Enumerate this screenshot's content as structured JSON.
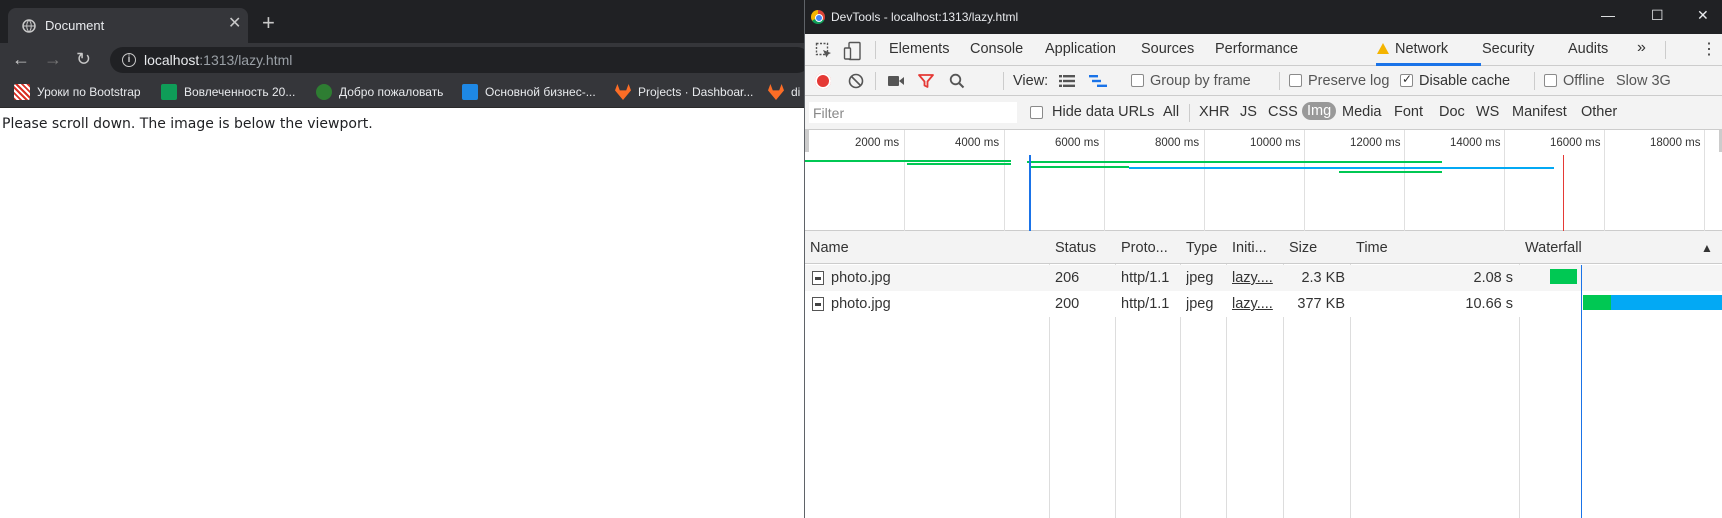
{
  "browser": {
    "tab_title": "Document",
    "new_tab": "+",
    "close_tab": "✕",
    "url_host": "localhost",
    "url_path": ":1313/lazy.html",
    "bookmarks": [
      {
        "label": "Уроки по Bootstrap",
        "color": "#d93025"
      },
      {
        "label": "Вовлеченность 20...",
        "color": "#0f9d58"
      },
      {
        "label": "Добро пожаловать",
        "color": "#2e7d32"
      },
      {
        "label": "Основной бизнес-...",
        "color": "#1e88e5"
      },
      {
        "label": "Projects · Dashboar...",
        "color": "#fc6d26"
      },
      {
        "label": "di",
        "color": "#fc6d26"
      }
    ],
    "page_text": "Please scroll down. The image is below the viewport."
  },
  "devtools": {
    "window_title": "DevTools - localhost:1313/lazy.html",
    "tabs": [
      "Elements",
      "Console",
      "Application",
      "Sources",
      "Performance",
      "Network",
      "Security",
      "Audits"
    ],
    "active_tab": "Network",
    "more_tabs": "»",
    "menu": "⋮",
    "toolbar": {
      "view_label": "View:",
      "group_by_frame": "Group by frame",
      "preserve_log": "Preserve log",
      "disable_cache": "Disable cache",
      "disable_cache_checked": true,
      "offline": "Offline",
      "throttle": "Slow 3G"
    },
    "filterbar": {
      "filter_placeholder": "Filter",
      "hide_data_urls": "Hide data URLs",
      "types": [
        "All",
        "XHR",
        "JS",
        "CSS",
        "Img",
        "Media",
        "Font",
        "Doc",
        "WS",
        "Manifest",
        "Other"
      ],
      "selected_type": "Img"
    },
    "overview": {
      "ticks": [
        "2000 ms",
        "4000 ms",
        "6000 ms",
        "8000 ms",
        "10000 ms",
        "12000 ms",
        "14000 ms",
        "16000 ms",
        "18000 ms"
      ]
    },
    "table": {
      "headers": {
        "name": "Name",
        "status": "Status",
        "protocol": "Proto...",
        "type": "Type",
        "initiator": "Initi...",
        "size": "Size",
        "time": "Time",
        "waterfall": "Waterfall",
        "sort_indicator": "▲"
      },
      "rows": [
        {
          "name": "photo.jpg",
          "status": "206",
          "protocol": "http/1.1",
          "type": "jpeg",
          "initiator": "lazy....",
          "size": "2.3 KB",
          "time": "2.08 s"
        },
        {
          "name": "photo.jpg",
          "status": "200",
          "protocol": "http/1.1",
          "type": "jpeg",
          "initiator": "lazy....",
          "size": "377 KB",
          "time": "10.66 s"
        }
      ]
    },
    "colors": {
      "waiting": "#00c853",
      "download": "#03a9f4",
      "dom_loaded": "#1a73e8",
      "load": "#e53935",
      "record": "#e53935",
      "filter_red": "#e53935"
    }
  }
}
